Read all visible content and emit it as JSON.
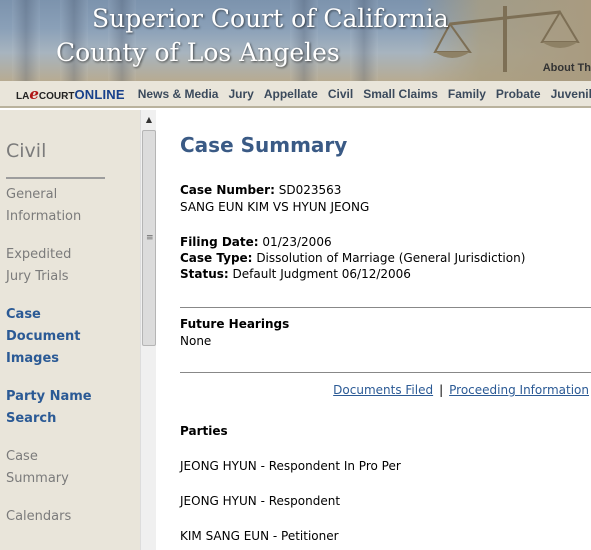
{
  "banner": {
    "line1": "Superior Court of California",
    "line2": "County of Los Angeles",
    "about": "About Th"
  },
  "logo": {
    "la": "LA",
    "e": "e",
    "court": "COURT",
    "online": "ONLINE"
  },
  "nav": {
    "items": [
      "News & Media",
      "Jury",
      "Appellate",
      "Civil",
      "Small Claims",
      "Family",
      "Probate",
      "Juvenile"
    ]
  },
  "sidebar": {
    "title": "Civil",
    "items": [
      {
        "line1": "General",
        "line2": "Information"
      },
      {
        "line1": "Expedited",
        "line2": "Jury Trials"
      },
      {
        "line1": "Case",
        "line2": "Document",
        "line3": "Images"
      },
      {
        "line1": "Party Name",
        "line2": "Search"
      },
      {
        "line1": "Case",
        "line2": "Summary"
      },
      {
        "line1": "Calendars"
      }
    ]
  },
  "colors": {
    "nav_bg": "#e9e5da",
    "title_blue": "#3a5a85",
    "link_blue": "#2b5a95",
    "sidebar_gray": "#7b7b7b"
  },
  "scrollbar": {
    "up_arrow": "▲"
  },
  "case": {
    "page_title": "Case Summary",
    "case_number_label": "Case Number:",
    "case_number": "SD023563",
    "case_name": "SANG EUN KIM VS HYUN JEONG",
    "filing_date_label": "Filing Date:",
    "filing_date": "01/23/2006",
    "case_type_label": "Case Type:",
    "case_type": "Dissolution of Marriage (General Jurisdiction)",
    "status_label": "Status:",
    "status": "Default Judgment 06/12/2006",
    "future_hearings_label": "Future Hearings",
    "future_hearings": "None",
    "link_documents": "Documents Filed",
    "link_separator": "|",
    "link_proceedings": "Proceeding Information",
    "parties_label": "Parties",
    "parties": [
      "JEONG HYUN - Respondent In Pro Per",
      "JEONG HYUN - Respondent",
      "KIM SANG EUN - Petitioner"
    ]
  }
}
